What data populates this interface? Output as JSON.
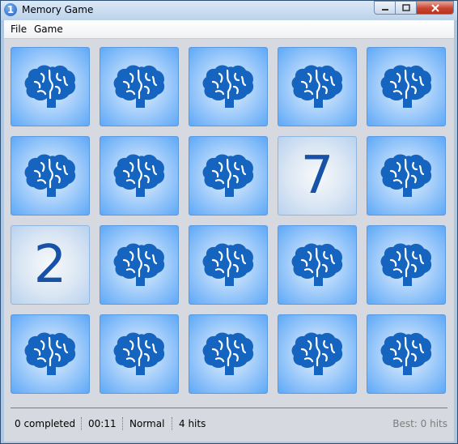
{
  "window": {
    "title": "Memory Game",
    "icon_label": "1",
    "controls": [
      "minimize",
      "maximize",
      "close"
    ]
  },
  "menu": {
    "items": [
      "File",
      "Game"
    ]
  },
  "board": {
    "rows": 4,
    "cols": 5,
    "card_back_icon": "brain-icon",
    "cards": [
      {
        "state": "hidden"
      },
      {
        "state": "hidden"
      },
      {
        "state": "hidden"
      },
      {
        "state": "hidden"
      },
      {
        "state": "hidden"
      },
      {
        "state": "hidden"
      },
      {
        "state": "hidden"
      },
      {
        "state": "hidden"
      },
      {
        "state": "revealed",
        "value": "7"
      },
      {
        "state": "hidden"
      },
      {
        "state": "revealed",
        "value": "2"
      },
      {
        "state": "hidden"
      },
      {
        "state": "hidden"
      },
      {
        "state": "hidden"
      },
      {
        "state": "hidden"
      },
      {
        "state": "hidden"
      },
      {
        "state": "hidden"
      },
      {
        "state": "hidden"
      },
      {
        "state": "hidden"
      },
      {
        "state": "hidden"
      }
    ]
  },
  "status": {
    "completed": "0  completed",
    "time": "00:11",
    "difficulty": "Normal",
    "hits": "4 hits",
    "best": "Best: 0 hits"
  },
  "colors": {
    "card_blue": "#5ea8f7",
    "brain_blue": "#1565c0",
    "number_blue": "#1752a8"
  }
}
